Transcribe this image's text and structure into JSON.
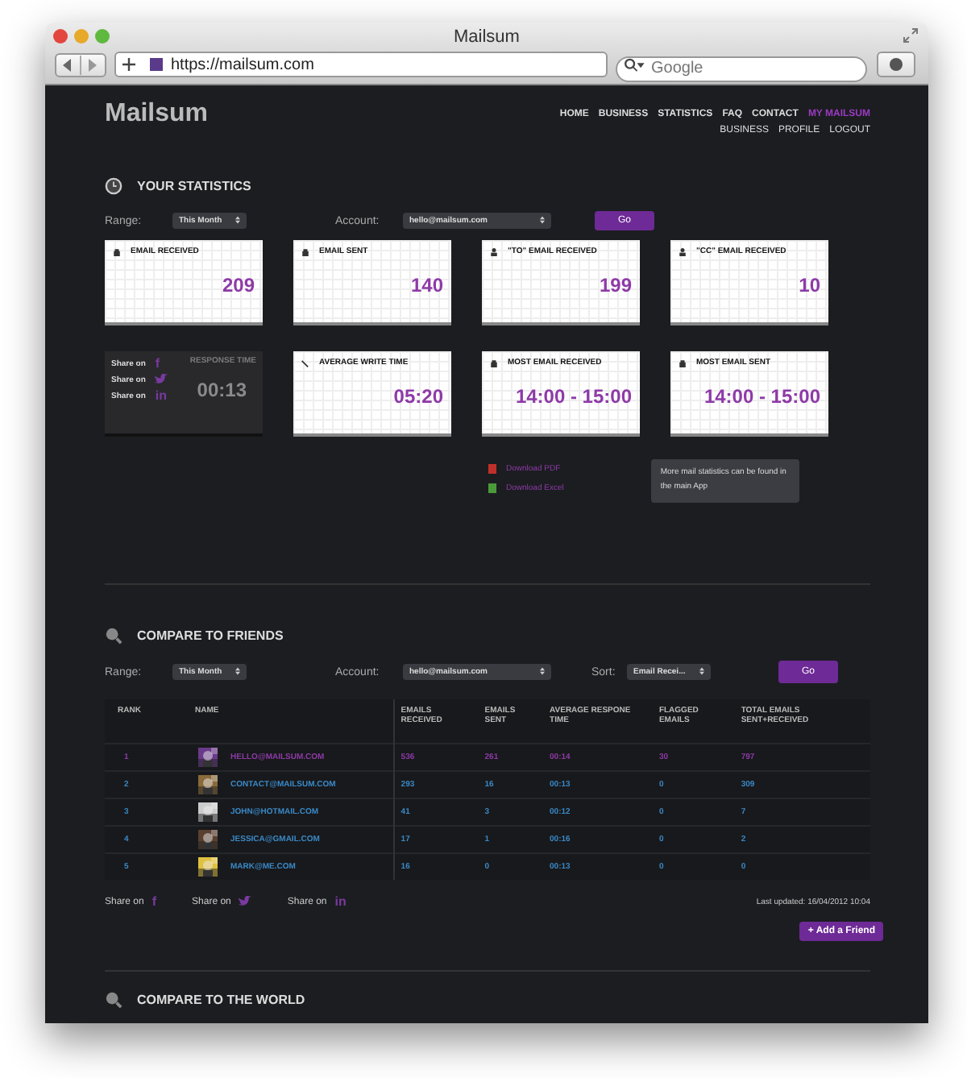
{
  "window": {
    "title": "Mailsum",
    "url": "https://mailsum.com",
    "search_placeholder": "Google"
  },
  "header": {
    "logo": "Mailsum",
    "nav": [
      {
        "label": "HOME",
        "selected": false
      },
      {
        "label": "BUSINESS",
        "selected": false
      },
      {
        "label": "STATISTICS",
        "selected": false
      },
      {
        "label": "FAQ",
        "selected": false
      },
      {
        "label": "CONTACT",
        "selected": false
      },
      {
        "label": "MY MAILSUM",
        "selected": true
      }
    ],
    "subnav": [
      "BUSINESS",
      "PROFILE",
      "LOGOUT"
    ]
  },
  "statistics": {
    "heading": "YOUR STATISTICS",
    "range_label": "Range:",
    "range": "This Month",
    "account_label": "Account:",
    "account": "hello@mailsum.com",
    "go": "Go",
    "cards": [
      {
        "title": "EMAIL RECEIVED",
        "value": "209",
        "kind": "inbox"
      },
      {
        "title": "EMAIL SENT",
        "value": "140",
        "kind": "inbox"
      },
      {
        "title": "\"TO\" EMAIL RECEIVED",
        "value": "199",
        "kind": "person"
      },
      {
        "title": "\"CC\" EMAIL RECEIVED",
        "value": "10",
        "kind": "person"
      },
      {
        "title": "RESPONSE TIME",
        "value": "00:13",
        "kind": "shared",
        "share": [
          {
            "label": "Share on",
            "icon": "f",
            "kind": "facebook"
          },
          {
            "label": "Share on",
            "kind": "twitter"
          },
          {
            "label": "Share on",
            "icon": "in",
            "kind": "linkedin"
          }
        ]
      },
      {
        "title": "AVERAGE WRITE TIME",
        "value": "05:20",
        "kind": "pen"
      },
      {
        "title": "MOST EMAIL RECEIVED",
        "value": "14:00 - 15:00",
        "kind": "tray"
      },
      {
        "title": "MOST EMAIL SENT",
        "value": "14:00 - 15:00",
        "kind": "tray"
      }
    ],
    "downloads": [
      {
        "label": "Download PDF",
        "kind": "pdf"
      },
      {
        "label": "Download Excel",
        "kind": "excel"
      }
    ],
    "note": "More mail statistics can be found in the main App"
  },
  "friends": {
    "heading": "COMPARE TO FRIENDS",
    "range_label": "Range:",
    "range": "This Month",
    "account_label": "Account:",
    "account": "hello@mailsum.com",
    "sort_label": "Sort:",
    "sort": "Email Recei...",
    "go": "Go",
    "table": {
      "columns": [
        "RANK",
        "NAME",
        "EMAILS RECEIVED",
        "EMAILS SENT",
        "AVERAGE RESPONE TIME",
        "FLAGGED EMAILS",
        "TOTAL EMAILS SENT+RECEIVED"
      ],
      "rows": [
        {
          "selected": true,
          "cells": [
            "1",
            "HELLO@MAILSUM.COM",
            "536",
            "261",
            "00:14",
            "30",
            "797"
          ]
        },
        {
          "selected": false,
          "cells": [
            "2",
            "CONTACT@MAILSUM.COM",
            "293",
            "16",
            "00:13",
            "0",
            "309"
          ]
        },
        {
          "selected": false,
          "cells": [
            "3",
            "JOHN@HOTMAIL.COM",
            "41",
            "3",
            "00:12",
            "0",
            "7"
          ]
        },
        {
          "selected": false,
          "cells": [
            "4",
            "JESSICA@GMAIL.COM",
            "17",
            "1",
            "00:16",
            "0",
            "2"
          ]
        },
        {
          "selected": false,
          "cells": [
            "5",
            "MARK@ME.COM",
            "16",
            "0",
            "00:13",
            "0",
            "0"
          ]
        }
      ]
    },
    "share": [
      {
        "label": "Share on",
        "icon": "f",
        "kind": "facebook"
      },
      {
        "label": "Share on",
        "kind": "twitter"
      },
      {
        "label": "Share on",
        "icon": "in",
        "kind": "linkedin"
      }
    ],
    "last_updated": "Last updated: 16/04/2012 10:04",
    "add_friend": "+ Add a Friend"
  },
  "world": {
    "heading": "COMPARE TO THE WORLD"
  }
}
